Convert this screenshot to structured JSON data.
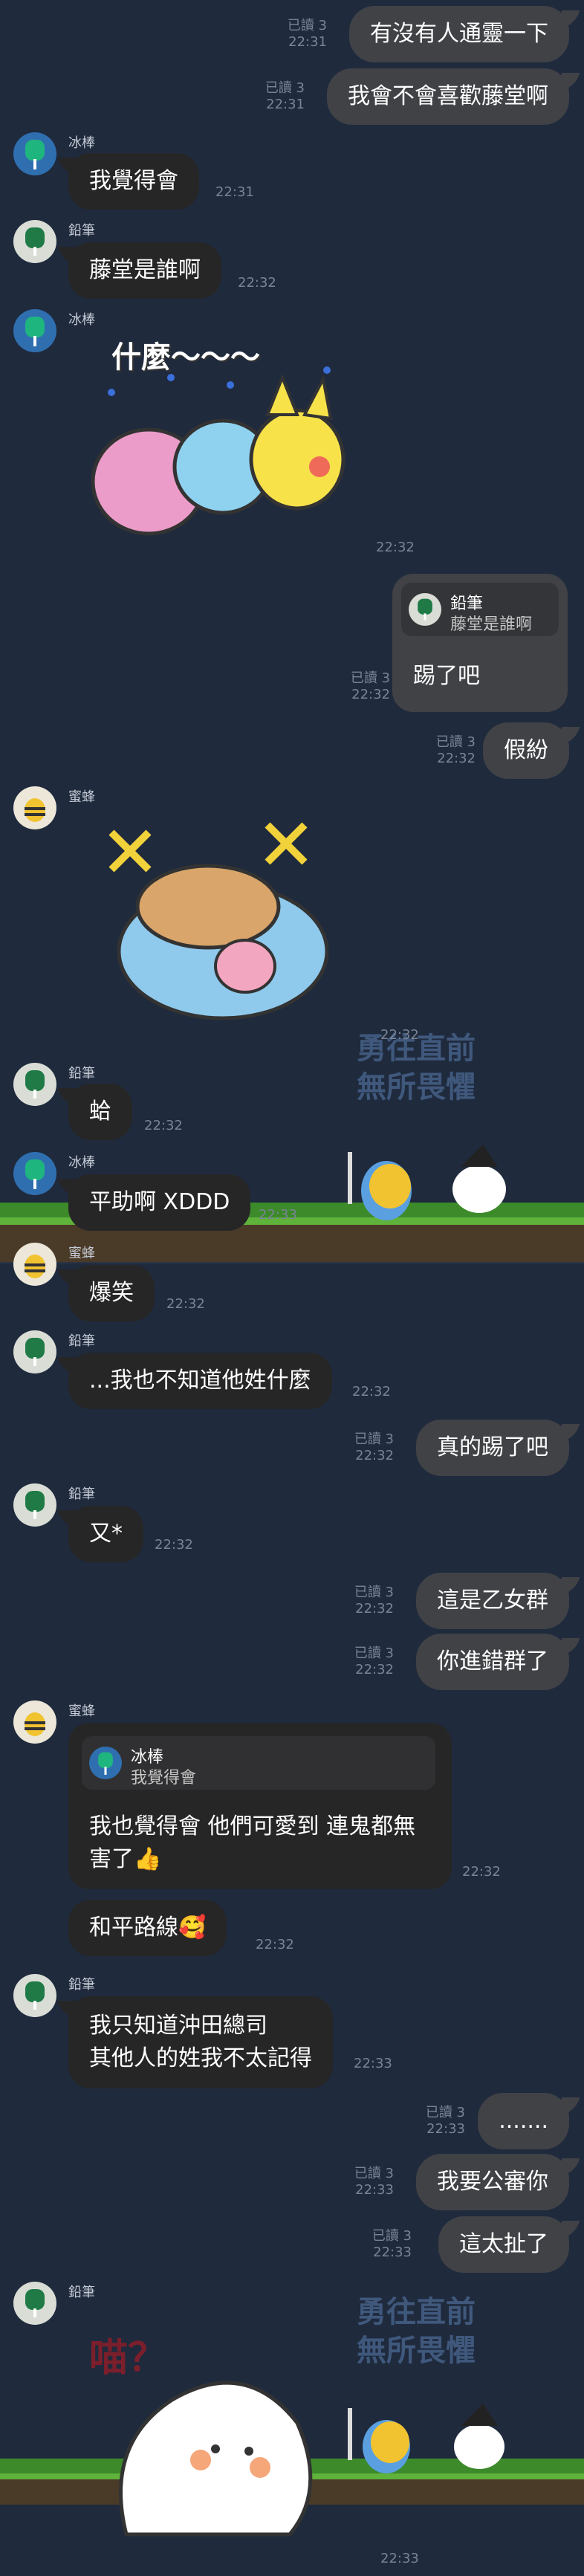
{
  "names": {
    "popsicle": "冰棒",
    "pencil": "鉛筆",
    "bee": "蜜蜂"
  },
  "read": "已讀 3",
  "msgs": {
    "m1": {
      "text": "有沒有人通靈一下",
      "time": "22:31"
    },
    "m2": {
      "text": "我會不會喜歡藤堂啊",
      "time": "22:31"
    },
    "m3": {
      "text": "我覺得會",
      "time": "22:31"
    },
    "m4": {
      "text": "藤堂是誰啊",
      "time": "22:32"
    },
    "m5": {
      "time": "22:32",
      "sticker_text": "什麼～～～"
    },
    "m6": {
      "quote_name": "鉛筆",
      "quote_text": "藤堂是誰啊",
      "text": "踢了吧",
      "time": "22:32"
    },
    "m7": {
      "text": "假紛",
      "time": "22:32"
    },
    "m8": {
      "time": "22:32"
    },
    "m9": {
      "text": "蛤",
      "time": "22:32"
    },
    "m10": {
      "text": "平助啊 XDDD",
      "time": "22:33"
    },
    "m11": {
      "text": "爆笑",
      "time": "22:32"
    },
    "m12": {
      "text": "...我也不知道他姓什麼",
      "time": "22:32"
    },
    "m13": {
      "text": "真的踢了吧",
      "time": "22:32"
    },
    "m14": {
      "text": "又*",
      "time": "22:32"
    },
    "m15": {
      "text": "這是乙女群",
      "time": "22:32"
    },
    "m16": {
      "text": "你進錯群了",
      "time": "22:32"
    },
    "m17": {
      "quote_name": "冰棒",
      "quote_text": "我覺得會",
      "line1": "我也覺得會 他們可愛到 連鬼都無",
      "line2": "害了👍",
      "time": "22:32"
    },
    "m18": {
      "text": "和平路線🥰",
      "time": "22:32"
    },
    "m19": {
      "line1": "我只知道沖田總司",
      "line2": "其他人的姓我不太記得",
      "time": "22:33"
    },
    "m20": {
      "text": ".......",
      "time": "22:33"
    },
    "m21": {
      "text": "我要公審你",
      "time": "22:33"
    },
    "m22": {
      "text": "這太扯了",
      "time": "22:33"
    },
    "m23": {
      "time": "22:33",
      "sticker_text": "喵？"
    }
  },
  "overlay": {
    "line1": "勇往直前",
    "line2": "無所畏懼"
  }
}
